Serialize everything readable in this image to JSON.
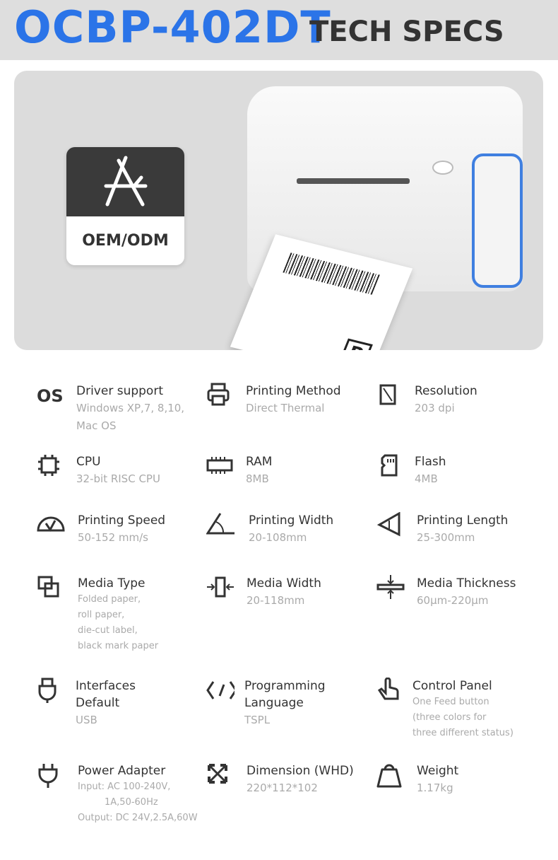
{
  "header": {
    "model": "OCBP-402DT",
    "subtitle": "TECH SPECS"
  },
  "colors": {
    "brand": "#2b74e8",
    "header_bg": "#dedede",
    "hero_bg": "#dcdcdc",
    "title": "#333333",
    "value": "#aaaaaa"
  },
  "hero": {
    "badge_label": "OEM/ODM",
    "badge_icon": "app-store-icon"
  },
  "specs": [
    {
      "icon": "os-icon",
      "icon_text": "OS",
      "title": [
        "Driver support"
      ],
      "value": [
        "Windows XP,7, 8,10,",
        "Mac OS"
      ]
    },
    {
      "icon": "printer-icon",
      "title": [
        "Printing Method"
      ],
      "value": [
        "Direct Thermal"
      ]
    },
    {
      "icon": "resolution-icon",
      "title": [
        "Resolution"
      ],
      "value": [
        "203 dpi"
      ]
    },
    {
      "icon": "cpu-icon",
      "title": [
        "CPU"
      ],
      "value": [
        "32-bit RISC CPU"
      ]
    },
    {
      "icon": "ram-icon",
      "title": [
        "RAM"
      ],
      "value": [
        "8MB"
      ]
    },
    {
      "icon": "flash-card-icon",
      "title": [
        "Flash"
      ],
      "value": [
        "4MB"
      ]
    },
    {
      "icon": "speedometer-icon",
      "title": [
        "Printing Speed"
      ],
      "value": [
        "50-152 mm/s"
      ]
    },
    {
      "icon": "angle-icon",
      "title": [
        "Printing Width"
      ],
      "value": [
        "20-108mm"
      ]
    },
    {
      "icon": "length-icon",
      "title": [
        "Printing Length"
      ],
      "value": [
        "25-300mm"
      ]
    },
    {
      "icon": "media-type-icon",
      "title": [
        "Media Type"
      ],
      "value": [
        "Folded paper,",
        "roll paper,",
        "die-cut label,",
        "black mark paper"
      ]
    },
    {
      "icon": "media-width-icon",
      "title": [
        "Media Width"
      ],
      "value": [
        "20-118mm"
      ]
    },
    {
      "icon": "media-thickness-icon",
      "title": [
        "Media Thickness"
      ],
      "value": [
        "60μm-220μm"
      ]
    },
    {
      "icon": "usb-icon",
      "title": [
        "Interfaces",
        "Default"
      ],
      "value": [
        "USB"
      ]
    },
    {
      "icon": "code-icon",
      "title": [
        "Programming",
        "Language"
      ],
      "value": [
        "TSPL"
      ]
    },
    {
      "icon": "hand-pointer-icon",
      "title": [
        "Control Panel"
      ],
      "value": [
        "One Feed button",
        "(three colors for",
        "three different status)"
      ]
    },
    {
      "icon": "plug-icon",
      "title": [
        "Power Adapter"
      ],
      "value": [
        "Input: AC 100-240V,",
        "1A,50-60Hz",
        "Output: DC 24V,2.5A,60W"
      ]
    },
    {
      "icon": "expand-arrows-icon",
      "title": [
        "Dimension (WHD)"
      ],
      "value": [
        "220*112*102"
      ]
    },
    {
      "icon": "weight-icon",
      "title": [
        "Weight"
      ],
      "value": [
        "1.17kg"
      ]
    }
  ]
}
